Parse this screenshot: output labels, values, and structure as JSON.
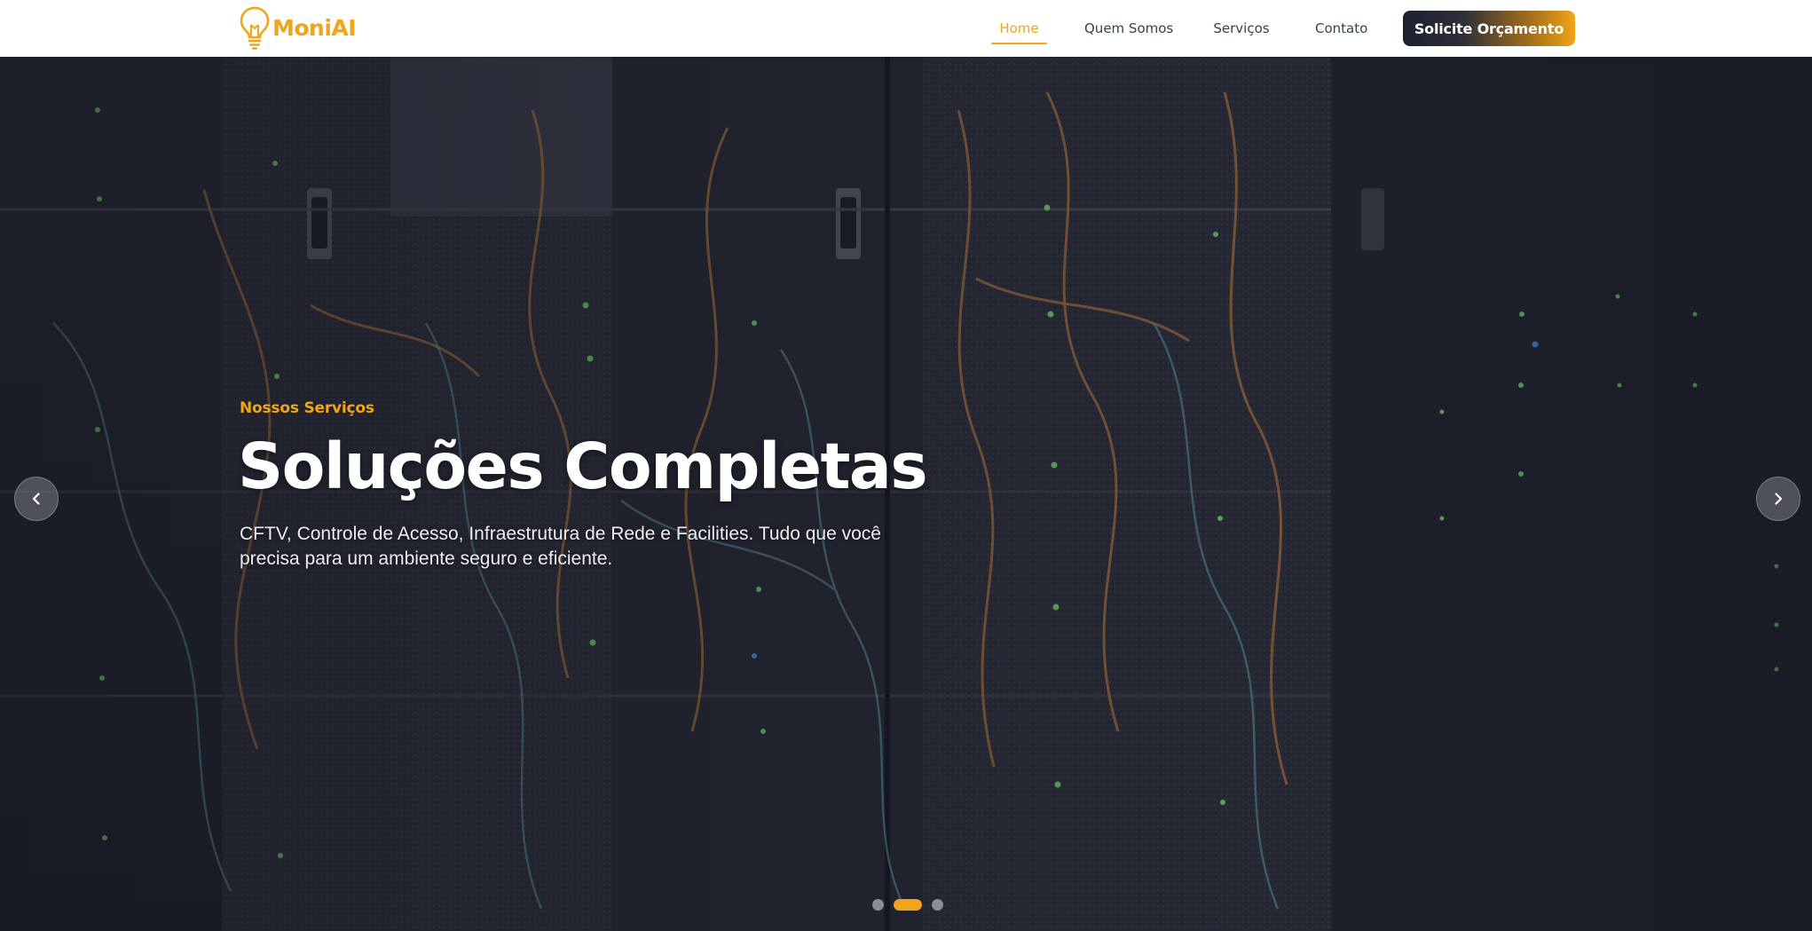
{
  "header": {
    "logo_text": "MoniAI",
    "nav": [
      {
        "label": "Home",
        "active": true
      },
      {
        "label": "Quem Somos",
        "active": false
      },
      {
        "label": "Serviços",
        "active": false
      },
      {
        "label": "Contato",
        "active": false
      }
    ],
    "cta_label": "Solicite Orçamento"
  },
  "hero": {
    "eyebrow": "Nossos Serviços",
    "title": "Soluções Completas",
    "description": "CFTV, Controle de Acesso, Infraestrutura de Rede e Facilities. Tudo que você precisa para um ambiente seguro e eficiente.",
    "prev_icon": "chevron-left-icon",
    "next_icon": "chevron-right-icon",
    "slide_count": 3,
    "active_slide_index": 1
  },
  "colors": {
    "accent": "#f2a518",
    "hero_bg": "#1c1f2a",
    "nav_text": "#374151",
    "cta_dark": "#1c2030"
  }
}
